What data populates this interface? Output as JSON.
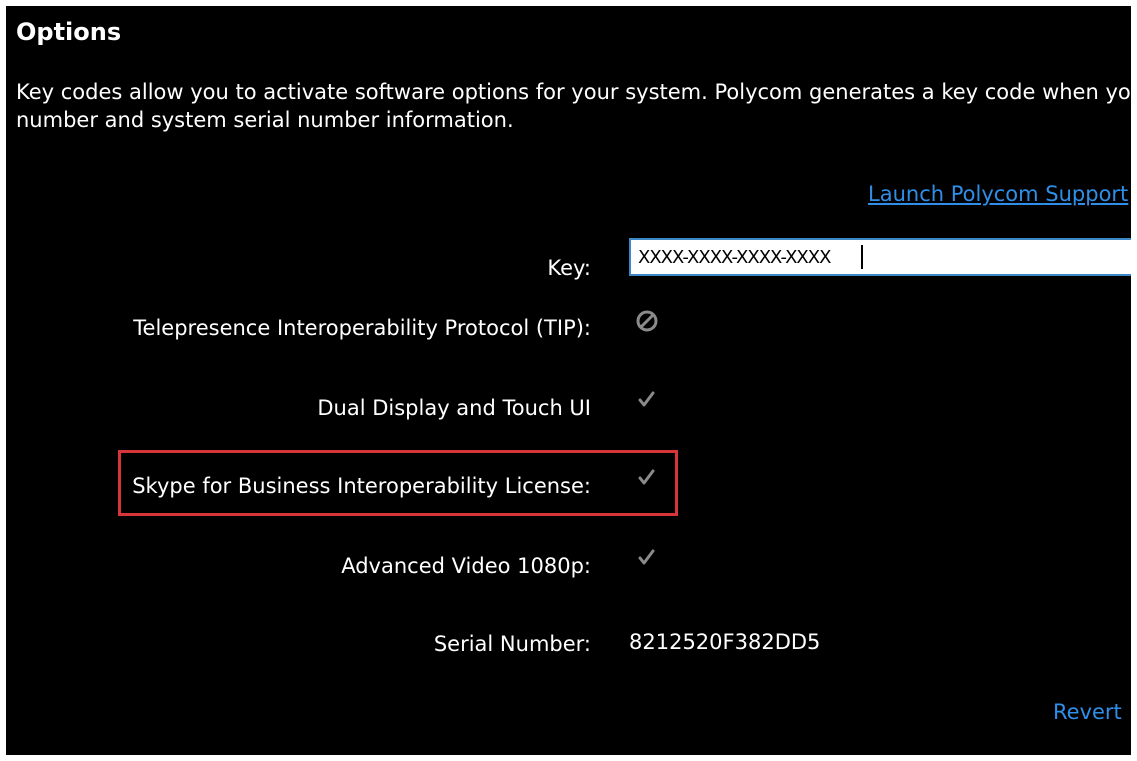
{
  "header": {
    "title": "Options"
  },
  "intro": {
    "line1": "Key codes allow you to activate software options for your system. Polycom generates a key code when you su",
    "line2": "number and system serial number information."
  },
  "support_link": "Launch Polycom Support",
  "form": {
    "key_label": "Key:",
    "key_value": "XXXX-XXXX-XXXX-XXXX",
    "options": [
      {
        "label": "Telepresence Interoperability Protocol (TIP):",
        "status_icon": "disabled-icon",
        "enabled": false
      },
      {
        "label": "Dual Display and Touch UI",
        "status_icon": "checkmark-icon",
        "enabled": true
      },
      {
        "label": "Skype for Business Interoperability License:",
        "status_icon": "checkmark-icon",
        "enabled": true,
        "highlighted": true
      },
      {
        "label": "Advanced Video 1080p:",
        "status_icon": "checkmark-icon",
        "enabled": true
      }
    ],
    "serial_label": "Serial Number:",
    "serial_value": "8212520F382DD5"
  },
  "actions": {
    "revert_label": "Revert"
  },
  "colors": {
    "background": "#000000",
    "text": "#ffffff",
    "link": "#2f8fe8",
    "highlight": "#d6353a",
    "input_border": "#3b87c8",
    "icon": "#8a8a8a"
  }
}
